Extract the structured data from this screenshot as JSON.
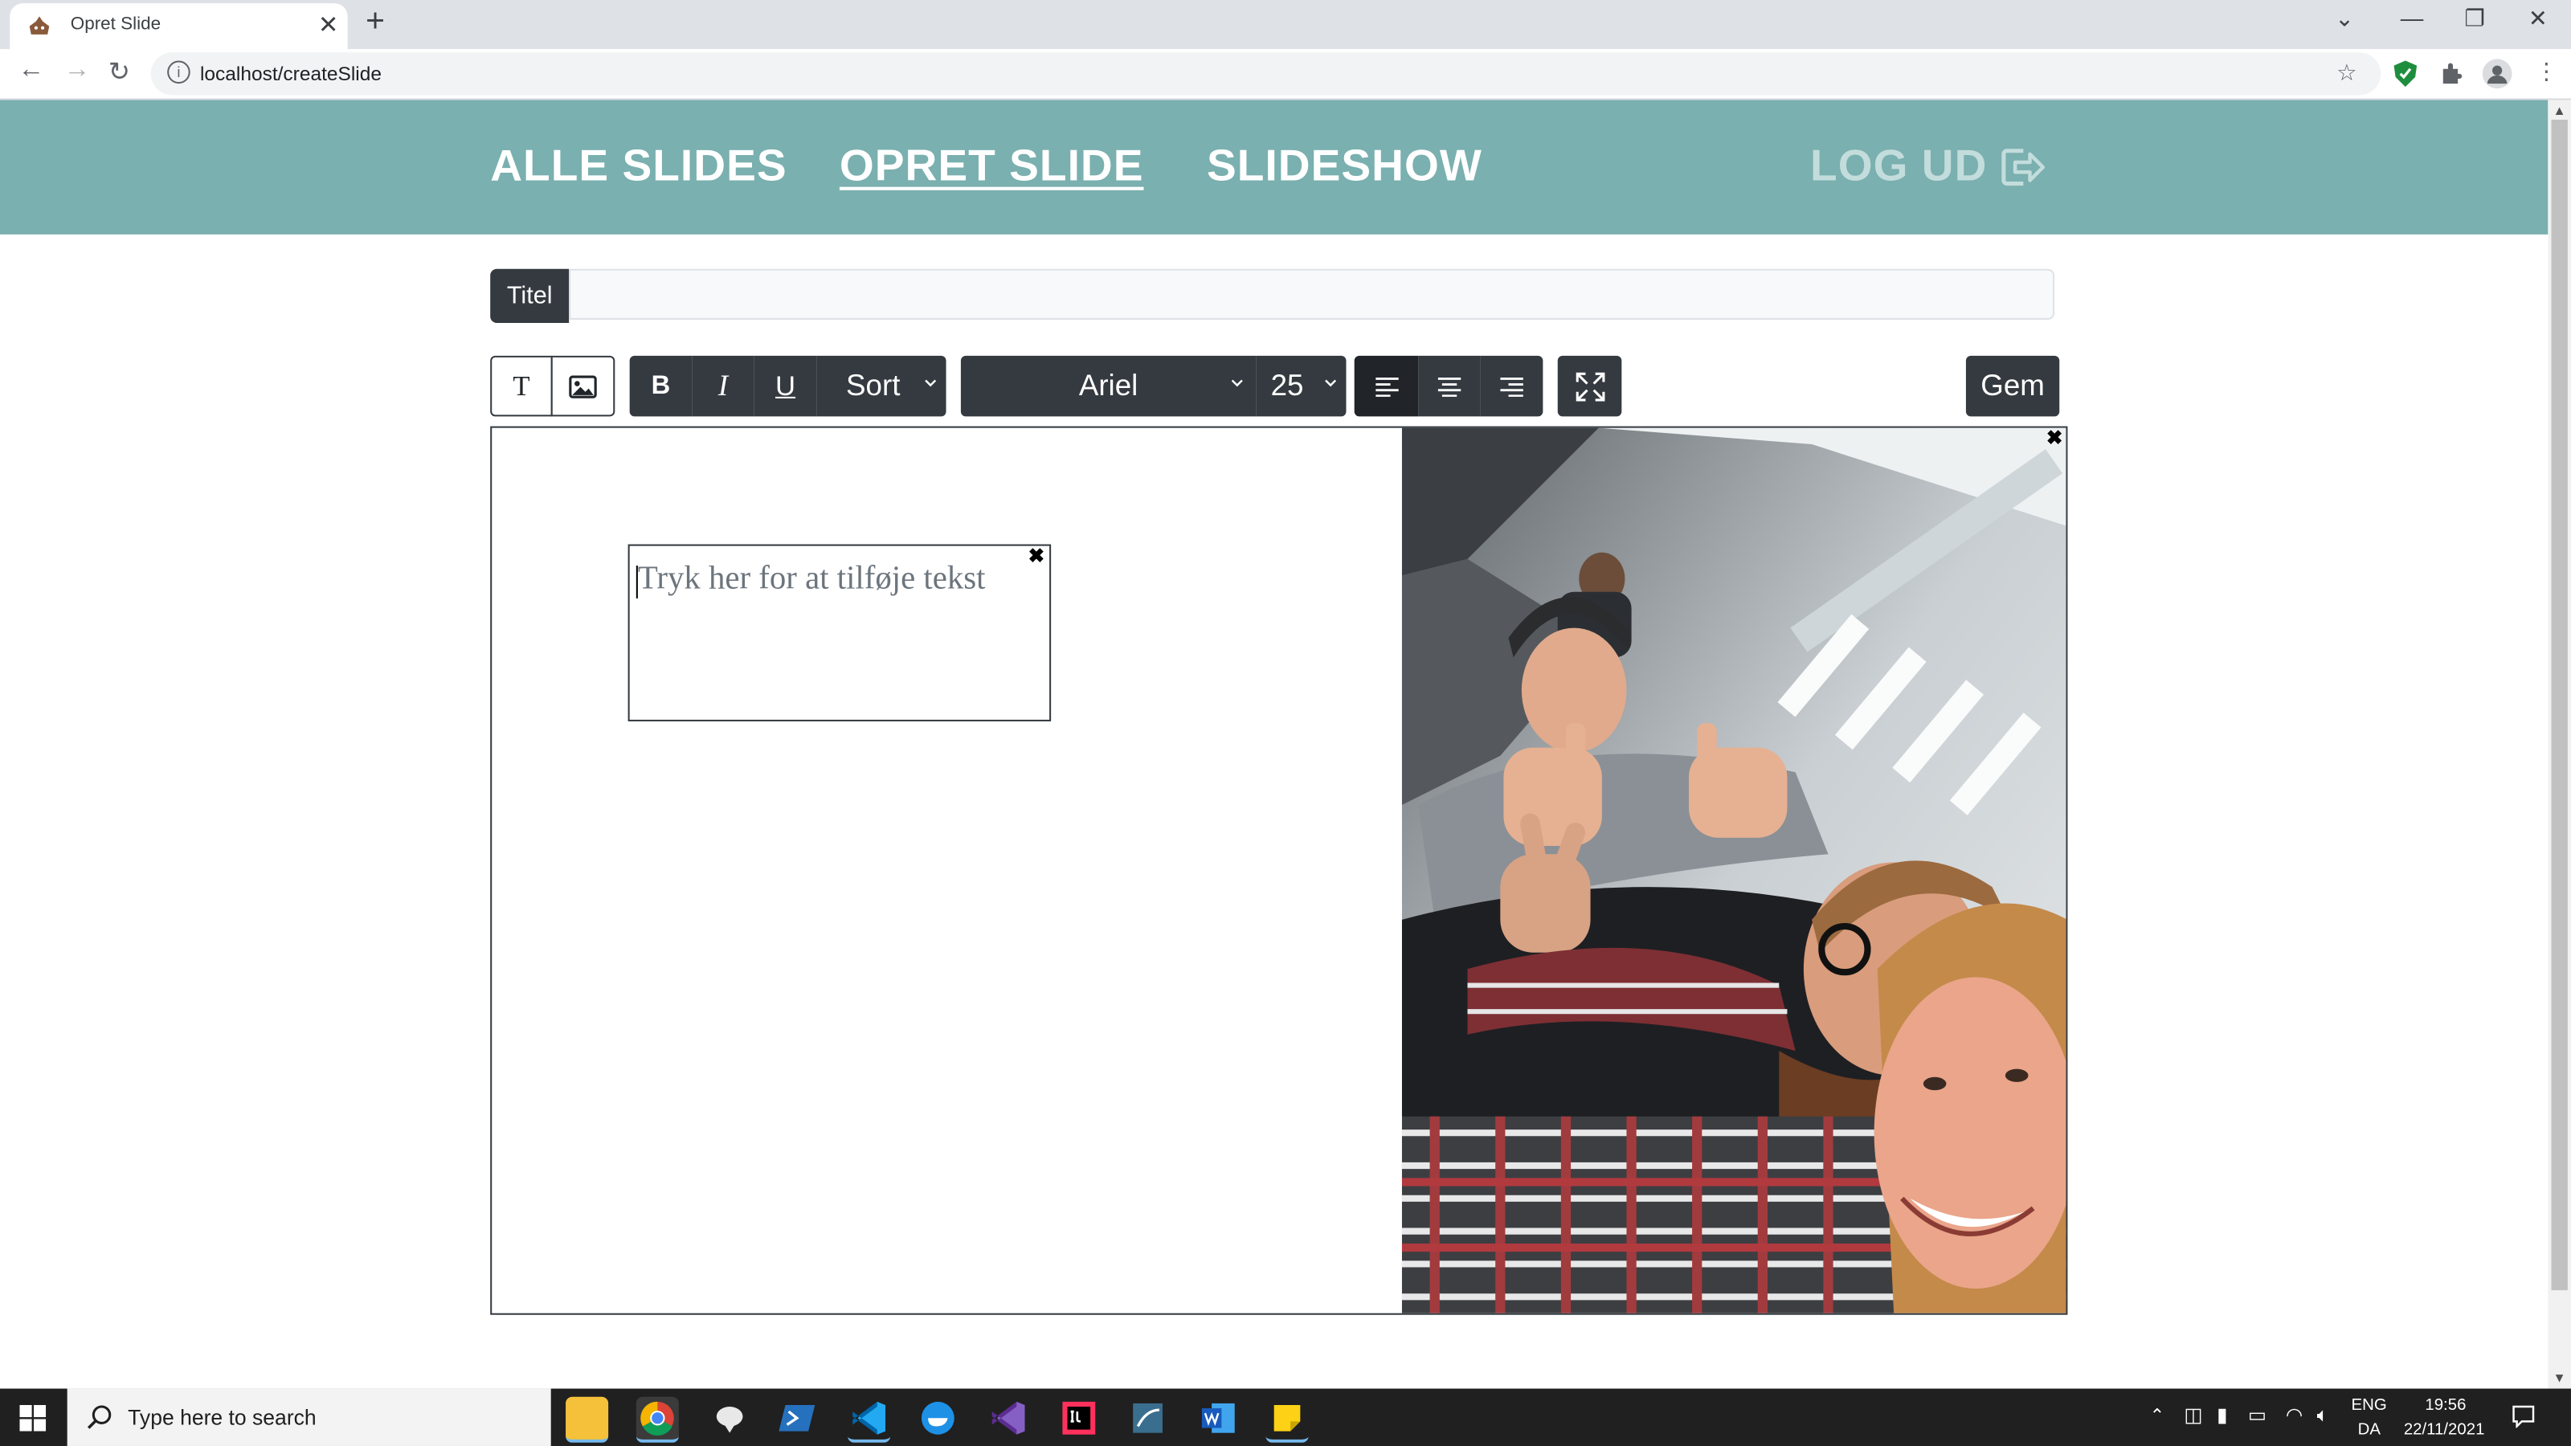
{
  "browser": {
    "tab_title": "Opret Slide",
    "url": "localhost/createSlide"
  },
  "nav": {
    "all_slides": "ALLE SLIDES",
    "create_slide": "OPRET SLIDE",
    "slideshow": "SLIDESHOW",
    "logout": "LOG UD"
  },
  "title_field": {
    "label": "Titel",
    "value": ""
  },
  "toolbar": {
    "text_tool": "T",
    "bold": "B",
    "italic": "I",
    "underline": "U",
    "color": "Sort",
    "font": "Ariel",
    "size": "25",
    "save": "Gem"
  },
  "canvas": {
    "textbox_placeholder": "Tryk her for at tilføje tekst",
    "close_symbol": "✖"
  },
  "taskbar": {
    "search_placeholder": "Type here to search",
    "lang_top": "ENG",
    "lang_bottom": "DA",
    "time": "19:56",
    "date": "22/11/2021"
  },
  "colors": {
    "nav_bg": "#7ab0af",
    "dark": "#343a40"
  }
}
